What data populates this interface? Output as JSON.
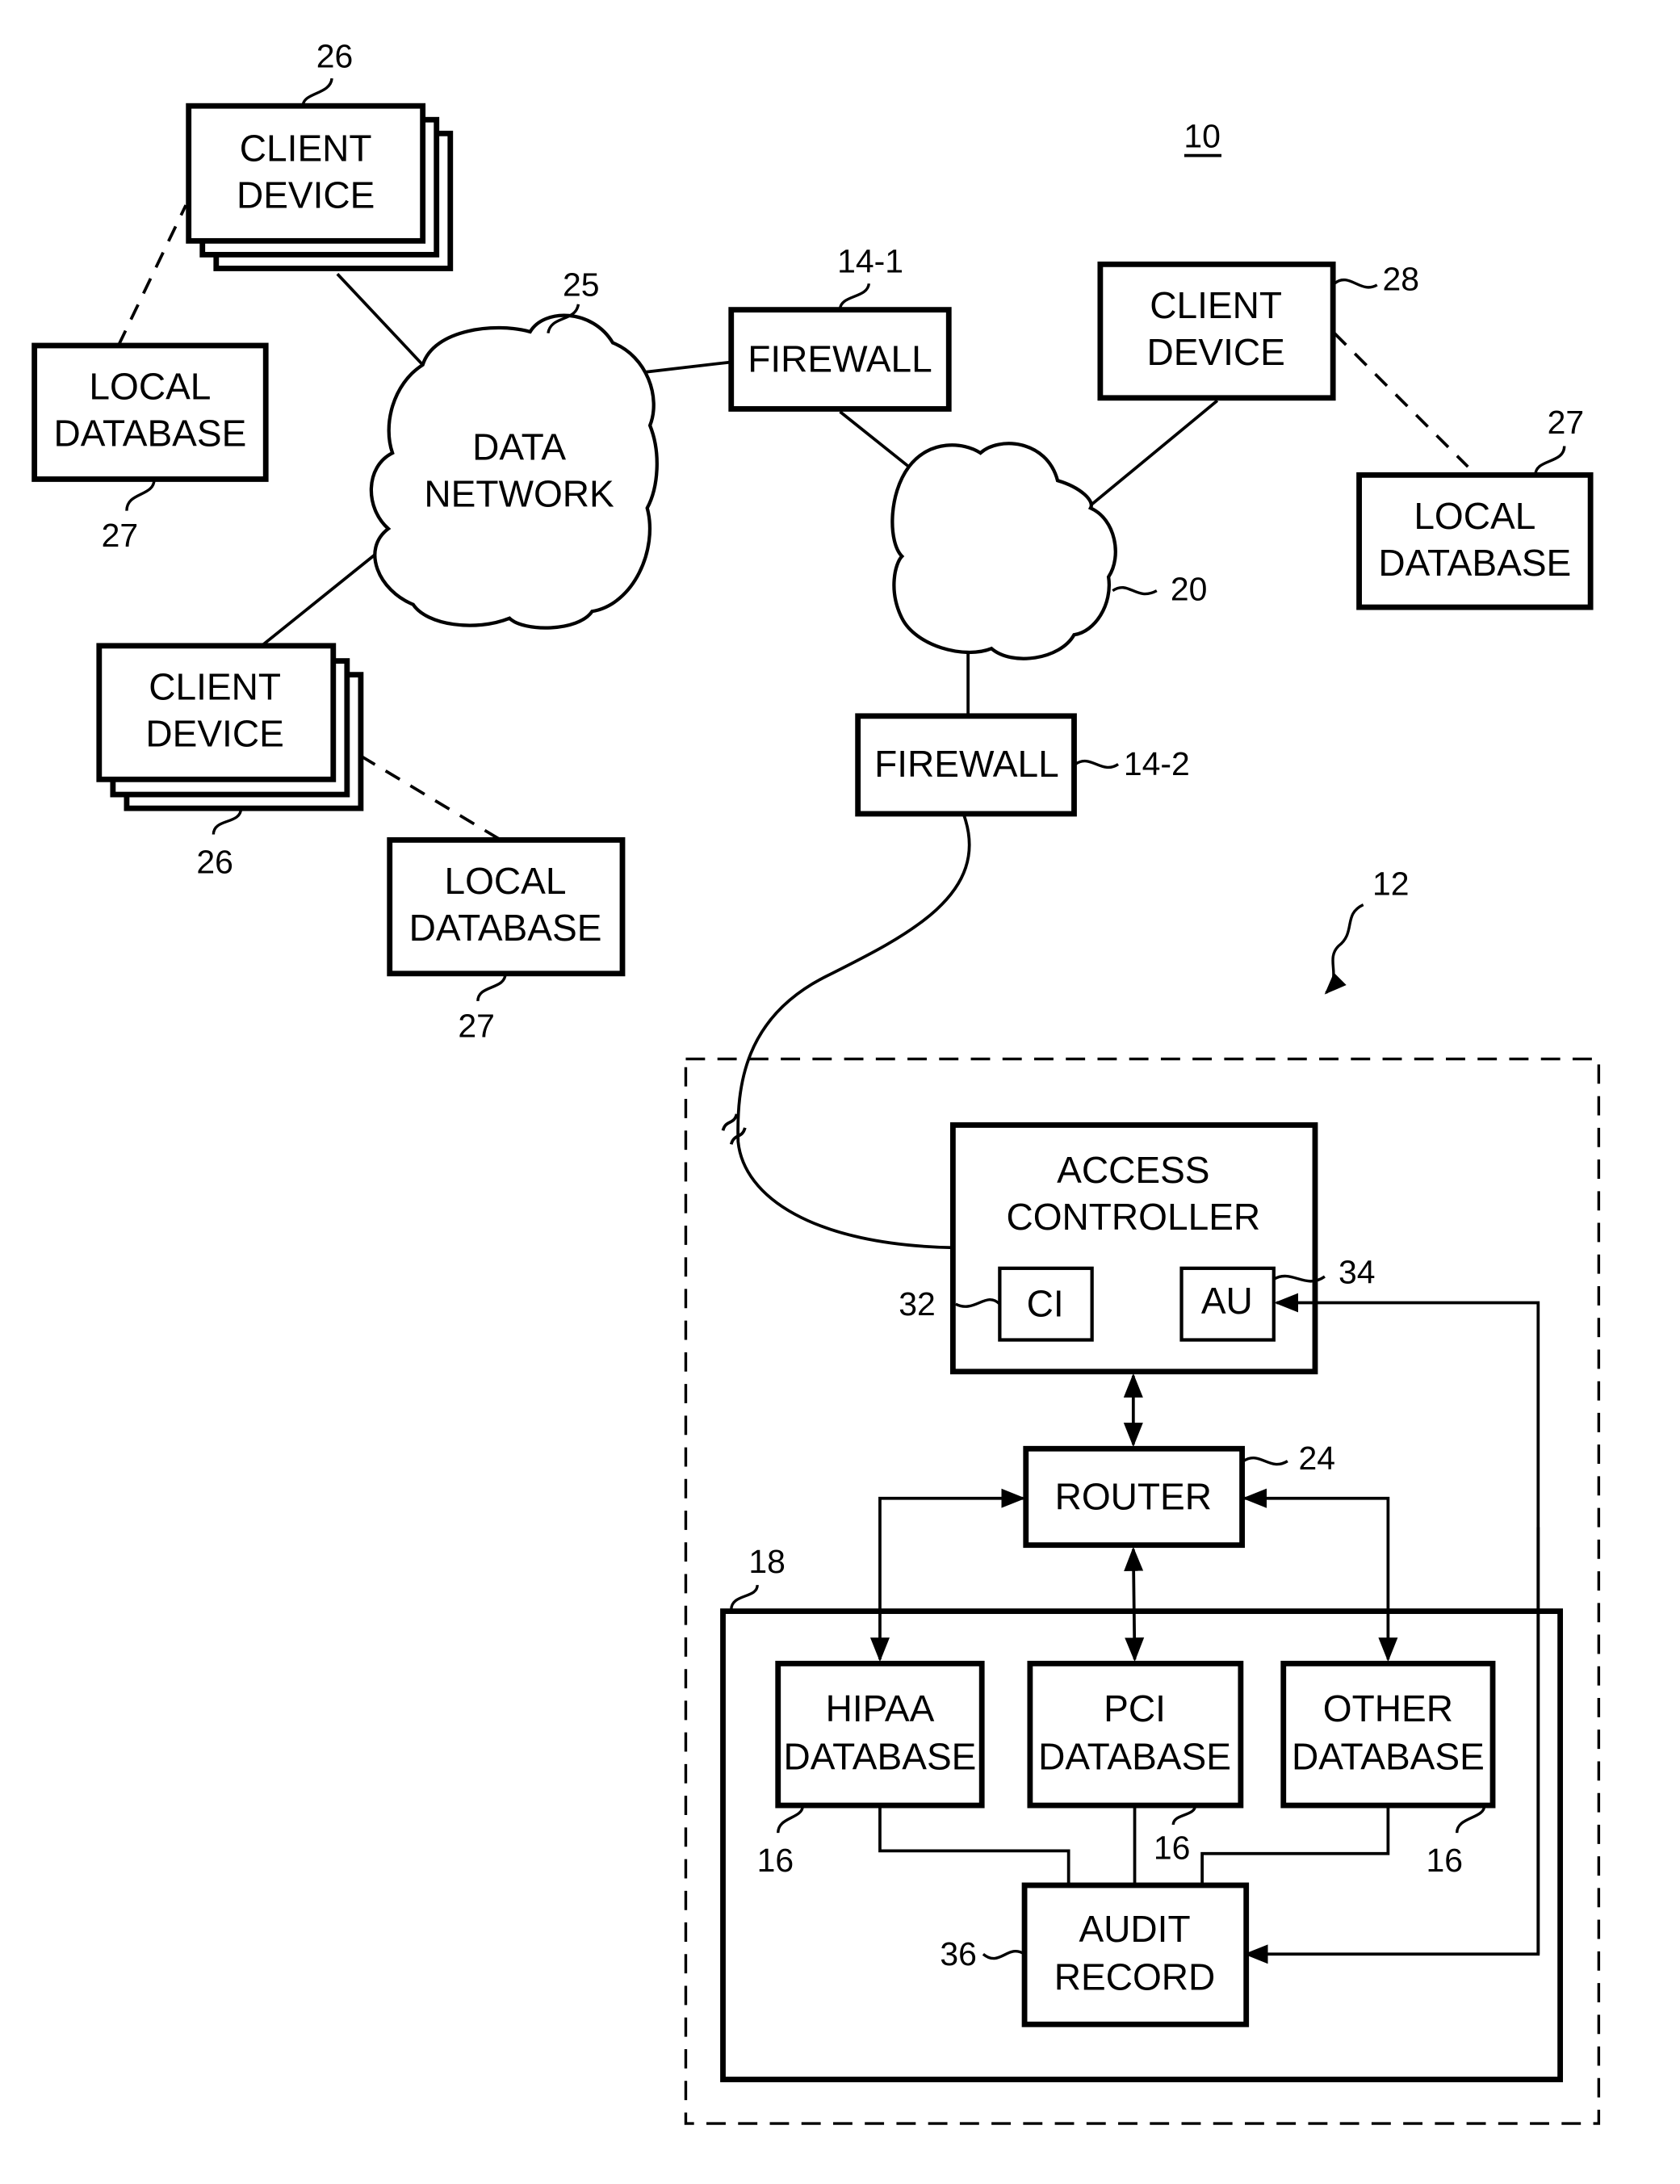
{
  "figure": {
    "ref_system": "10",
    "ref_secure_zone": "12"
  },
  "nodes": {
    "client_top": {
      "line1": "CLIENT",
      "line2": "DEVICE",
      "ref": "26"
    },
    "local_db_left": {
      "line1": "LOCAL",
      "line2": "DATABASE",
      "ref": "27"
    },
    "data_network": {
      "line1": "DATA",
      "line2": "NETWORK",
      "ref": "25"
    },
    "client_bottom": {
      "line1": "CLIENT",
      "line2": "DEVICE",
      "ref": "26"
    },
    "local_db_bottom": {
      "line1": "LOCAL",
      "line2": "DATABASE",
      "ref": "27"
    },
    "firewall_1": {
      "label": "FIREWALL",
      "ref": "14-1"
    },
    "network_20": {
      "ref": "20"
    },
    "client_right": {
      "line1": "CLIENT",
      "line2": "DEVICE",
      "ref": "28"
    },
    "local_db_right": {
      "line1": "LOCAL",
      "line2": "DATABASE",
      "ref": "27"
    },
    "firewall_2": {
      "label": "FIREWALL",
      "ref": "14-2"
    },
    "access_controller": {
      "line1": "ACCESS",
      "line2": "CONTROLLER"
    },
    "ci": {
      "label": "CI",
      "ref": "32"
    },
    "au": {
      "label": "AU",
      "ref": "34"
    },
    "router": {
      "label": "ROUTER",
      "ref": "24"
    },
    "db_group": {
      "ref": "18"
    },
    "hipaa_db": {
      "line1": "HIPAA",
      "line2": "DATABASE",
      "ref": "16"
    },
    "pci_db": {
      "line1": "PCI",
      "line2": "DATABASE",
      "ref": "16"
    },
    "other_db": {
      "line1": "OTHER",
      "line2": "DATABASE",
      "ref": "16"
    },
    "audit_record": {
      "line1": "AUDIT",
      "line2": "RECORD",
      "ref": "36"
    }
  }
}
